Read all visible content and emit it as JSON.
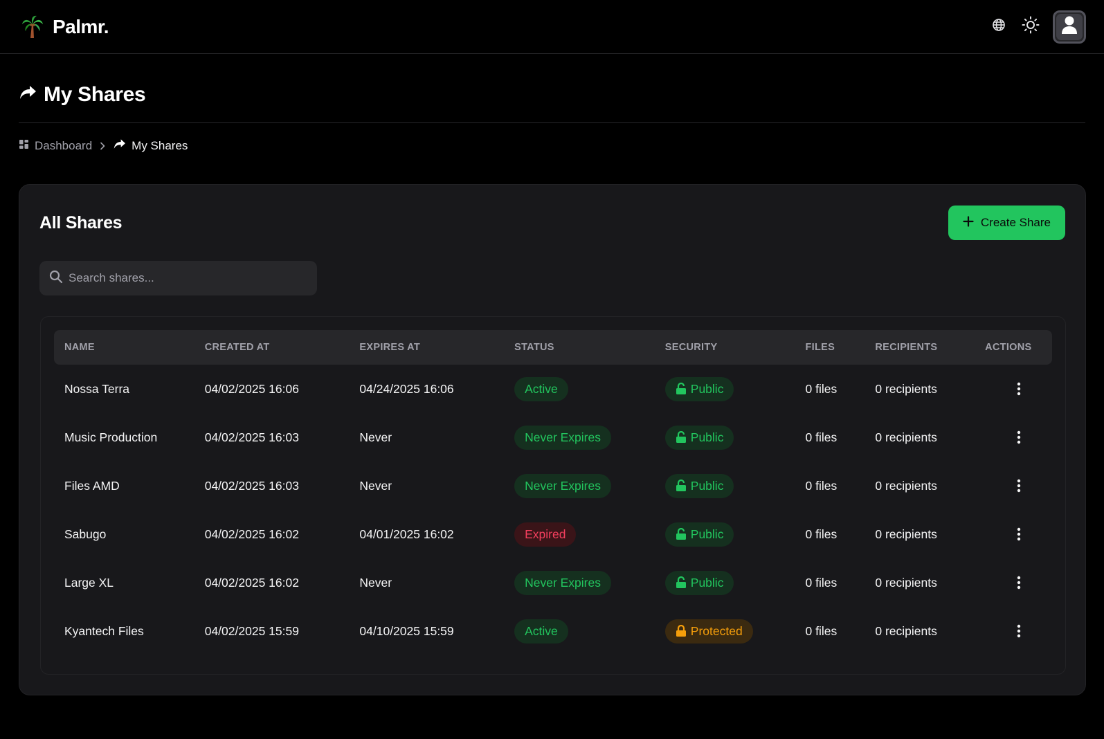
{
  "app": {
    "brand": "Palmr."
  },
  "page": {
    "title": "My Shares"
  },
  "breadcrumb": {
    "items": [
      {
        "label": "Dashboard"
      },
      {
        "label": "My Shares"
      }
    ]
  },
  "card": {
    "title": "All Shares",
    "create_label": "Create Share",
    "search_placeholder": "Search shares..."
  },
  "table": {
    "columns": [
      "NAME",
      "CREATED AT",
      "EXPIRES AT",
      "STATUS",
      "SECURITY",
      "FILES",
      "RECIPIENTS",
      "ACTIONS"
    ],
    "rows": [
      {
        "name": "Nossa Terra",
        "created": "04/02/2025 16:06",
        "expires": "04/24/2025 16:06",
        "status": "Active",
        "status_kind": "green",
        "security": "Public",
        "security_kind": "green",
        "files": "0 files",
        "recipients": "0 recipients"
      },
      {
        "name": "Music Production",
        "created": "04/02/2025 16:03",
        "expires": "Never",
        "status": "Never Expires",
        "status_kind": "green",
        "security": "Public",
        "security_kind": "green",
        "files": "0 files",
        "recipients": "0 recipients"
      },
      {
        "name": "Files AMD",
        "created": "04/02/2025 16:03",
        "expires": "Never",
        "status": "Never Expires",
        "status_kind": "green",
        "security": "Public",
        "security_kind": "green",
        "files": "0 files",
        "recipients": "0 recipients"
      },
      {
        "name": "Sabugo",
        "created": "04/02/2025 16:02",
        "expires": "04/01/2025 16:02",
        "status": "Expired",
        "status_kind": "red",
        "security": "Public",
        "security_kind": "green",
        "files": "0 files",
        "recipients": "0 recipients"
      },
      {
        "name": "Large XL",
        "created": "04/02/2025 16:02",
        "expires": "Never",
        "status": "Never Expires",
        "status_kind": "green",
        "security": "Public",
        "security_kind": "green",
        "files": "0 files",
        "recipients": "0 recipients"
      },
      {
        "name": "Kyantech Files",
        "created": "04/02/2025 15:59",
        "expires": "04/10/2025 15:59",
        "status": "Active",
        "status_kind": "green",
        "security": "Protected",
        "security_kind": "orange",
        "files": "0 files",
        "recipients": "0 recipients"
      }
    ]
  },
  "colors": {
    "accent": "#22c55e",
    "danger": "#f43f5e",
    "warning": "#f59e0b",
    "background": "#000000",
    "card": "#18181b"
  },
  "icons": {
    "logo": "palm-tree-icon",
    "language": "globe-icon",
    "theme": "sun-icon",
    "user": "user-icon",
    "page": "share-forward-icon",
    "dashboard": "grid-icon",
    "search": "search-icon",
    "create": "plus-icon",
    "lock_open": "lock-open-icon",
    "lock": "lock-icon",
    "actions": "kebab-menu-icon"
  }
}
